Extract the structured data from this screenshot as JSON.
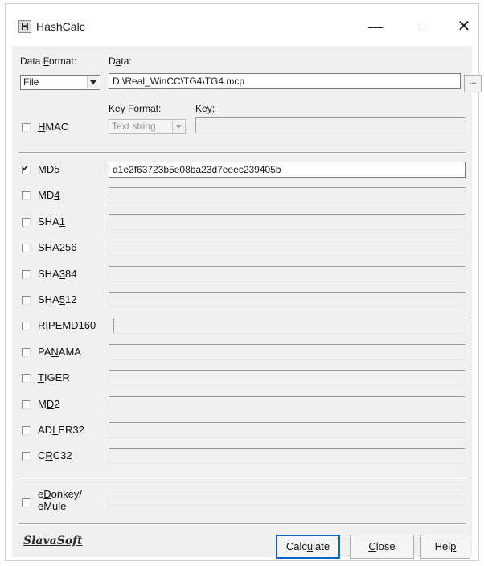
{
  "window": {
    "title": "HashCalc",
    "icon_letter": "H",
    "minimize_glyph": "—",
    "maximize_glyph": "□",
    "close_glyph": "✕"
  },
  "data_format": {
    "label_pre": "Data ",
    "label_key": "F",
    "label_post": "ormat:",
    "selected": "File"
  },
  "data": {
    "label_pre": "D",
    "label_key": "a",
    "label_post": "ta:",
    "value": "D:\\Real_WinCC\\TG4\\TG4.mcp",
    "browse_label": "..."
  },
  "hmac": {
    "label_pre": "",
    "label_key": "H",
    "label_post": "MAC",
    "checked": false,
    "key_format_label_pre": "",
    "key_format_label_key": "K",
    "key_format_label_post": "ey Format:",
    "key_format_value": "Text string",
    "key_label_pre": "Ke",
    "key_label_key": "y",
    "key_label_post": ":",
    "key_value": ""
  },
  "algorithms": [
    {
      "pre": "",
      "key": "M",
      "post": "D5",
      "checked": true,
      "value": "d1e2f63723b5e08ba23d7eeec239405b"
    },
    {
      "pre": "MD",
      "key": "4",
      "post": "",
      "checked": false,
      "value": ""
    },
    {
      "pre": "SHA",
      "key": "1",
      "post": "",
      "checked": false,
      "value": ""
    },
    {
      "pre": "SHA",
      "key": "2",
      "post": "56",
      "checked": false,
      "value": ""
    },
    {
      "pre": "SHA",
      "key": "3",
      "post": "84",
      "checked": false,
      "value": ""
    },
    {
      "pre": "SHA",
      "key": "5",
      "post": "12",
      "checked": false,
      "value": ""
    },
    {
      "pre": "R",
      "key": "I",
      "post": "PEMD160",
      "checked": false,
      "value": ""
    },
    {
      "pre": "PA",
      "key": "N",
      "post": "AMA",
      "checked": false,
      "value": ""
    },
    {
      "pre": "",
      "key": "T",
      "post": "IGER",
      "checked": false,
      "value": ""
    },
    {
      "pre": "M",
      "key": "D",
      "post": "2",
      "checked": false,
      "value": ""
    },
    {
      "pre": "AD",
      "key": "L",
      "post": "ER32",
      "checked": false,
      "value": ""
    },
    {
      "pre": "C",
      "key": "R",
      "post": "C32",
      "checked": false,
      "value": ""
    }
  ],
  "edonkey": {
    "line1_pre": "e",
    "line1_key": "D",
    "line1_post": "onkey/",
    "line2": "eMule",
    "checked": false,
    "value": ""
  },
  "footer": {
    "logo_text": "SlavaSoft",
    "calculate_pre": "Calc",
    "calculate_key": "u",
    "calculate_post": "late",
    "close_pre": "",
    "close_key": "C",
    "close_post": "lose",
    "help_pre": "Hel",
    "help_key": "p",
    "help_post": ""
  }
}
